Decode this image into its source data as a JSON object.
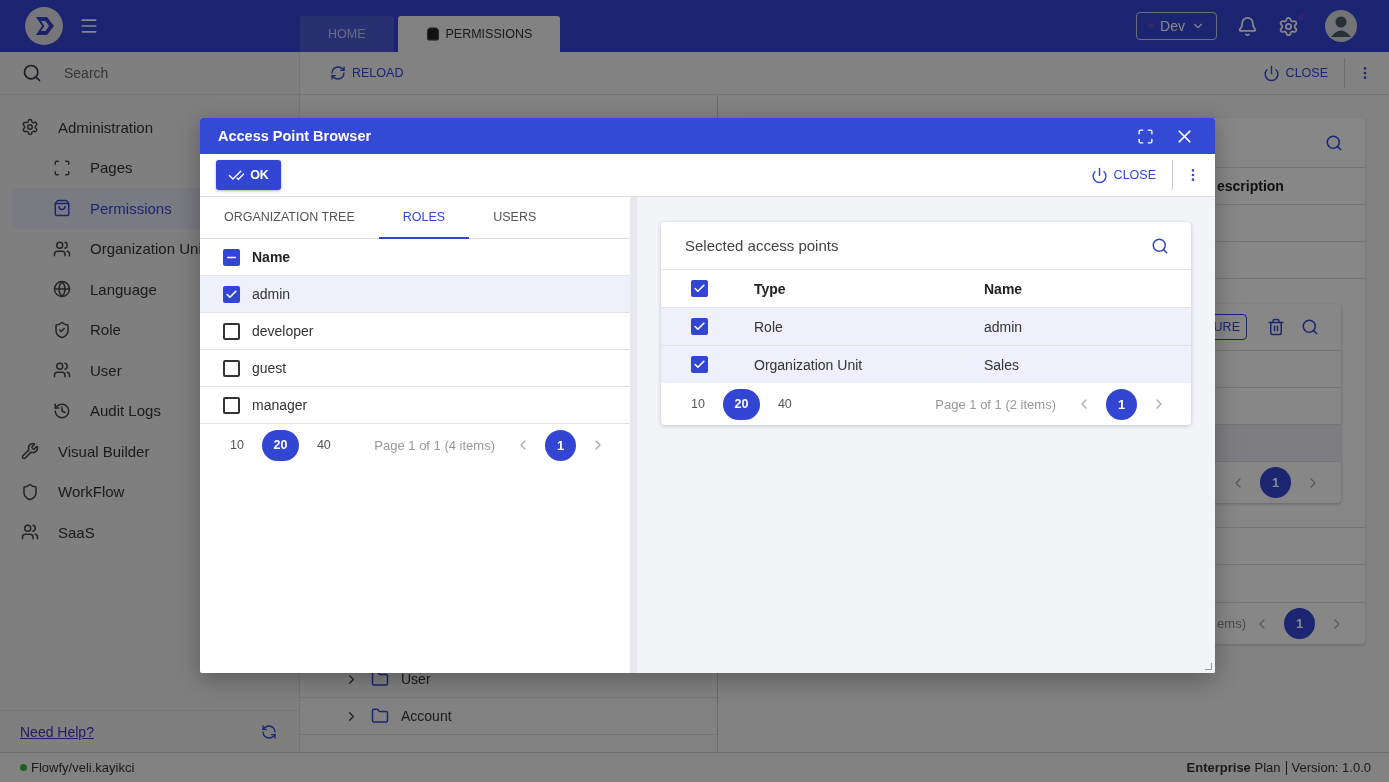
{
  "header": {
    "menu_tabs": [
      {
        "label": "HOME",
        "selected": false
      },
      {
        "label": "PERMISSIONS",
        "selected": true
      }
    ],
    "environment": "Dev"
  },
  "sidebar": {
    "search": {
      "placeholder": "Search"
    },
    "items": [
      {
        "label": "Administration",
        "selected": false,
        "children": [
          {
            "label": "Pages",
            "selected": false
          },
          {
            "label": "Permissions",
            "selected": true
          },
          {
            "label": "Organization Uni",
            "selected": false
          },
          {
            "label": "Language",
            "selected": false
          },
          {
            "label": "Role",
            "selected": false
          },
          {
            "label": "User",
            "selected": false
          },
          {
            "label": "Audit Logs",
            "selected": false
          }
        ]
      },
      {
        "label": "Visual Builder",
        "selected": false
      },
      {
        "label": "WorkFlow",
        "selected": false
      },
      {
        "label": "SaaS",
        "selected": false
      }
    ],
    "help_link": "Need Help?"
  },
  "toolbar": {
    "reload": "RELOAD",
    "close": "CLOSE"
  },
  "tree": {
    "rows": [
      {
        "label": "User"
      },
      {
        "label": "Account"
      }
    ]
  },
  "background_table": {
    "column": "escription",
    "inner_button": "URE",
    "inner_page": "1",
    "footer_text": "ems)",
    "footer_page": "1"
  },
  "dialog": {
    "title": "Access Point Browser",
    "ok": "OK",
    "close": "CLOSE",
    "tabs": [
      {
        "label": "ORGANIZATION TREE",
        "selected": false
      },
      {
        "label": "ROLES",
        "selected": true
      },
      {
        "label": "USERS",
        "selected": false
      }
    ],
    "roles": {
      "header": {
        "label": "Name",
        "indeterminate": true
      },
      "rows": [
        {
          "name": "admin",
          "checked": true
        },
        {
          "name": "developer",
          "checked": false
        },
        {
          "name": "guest",
          "checked": false
        },
        {
          "name": "manager",
          "checked": false
        }
      ],
      "pager": {
        "sizes": [
          {
            "label": "10",
            "selected": false
          },
          {
            "label": "20",
            "selected": true
          },
          {
            "label": "40",
            "selected": false
          }
        ],
        "summary": "Page 1 of 1 (4 items)",
        "pages": [
          {
            "label": "1",
            "selected": true
          }
        ]
      }
    },
    "selected": {
      "title": "Selected access points",
      "header": {
        "checked": true
      },
      "columns": [
        "Type",
        "Name"
      ],
      "rows": [
        {
          "cells": [
            "Role",
            "admin"
          ],
          "checked": true
        },
        {
          "cells": [
            "Organization Unit",
            "Sales"
          ],
          "checked": true
        }
      ],
      "pager": {
        "sizes": [
          {
            "label": "10",
            "selected": false
          },
          {
            "label": "20",
            "selected": true
          },
          {
            "label": "40",
            "selected": false
          }
        ],
        "summary": "Page 1 of 1 (2 items)",
        "pages": [
          {
            "label": "1",
            "selected": true
          }
        ]
      }
    }
  },
  "status_bar": {
    "user": "Flowfy/veli.kayikci",
    "plan": "**Enterprise** Plan",
    "version": "Version: 1.0.0"
  }
}
